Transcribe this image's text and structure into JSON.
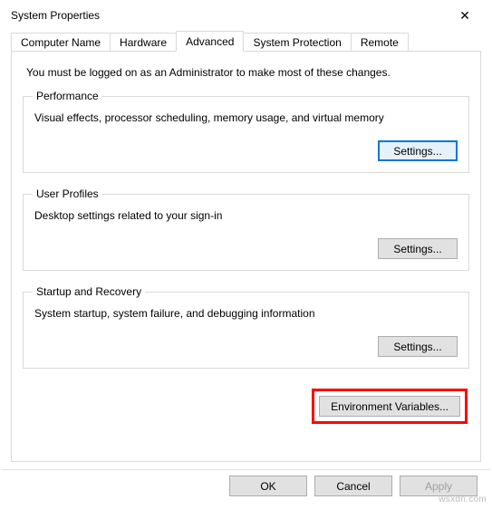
{
  "window": {
    "title": "System Properties",
    "close_glyph": "✕"
  },
  "tabs": {
    "computer_name": "Computer Name",
    "hardware": "Hardware",
    "advanced": "Advanced",
    "system_protection": "System Protection",
    "remote": "Remote"
  },
  "advanced_tab": {
    "intro": "You must be logged on as an Administrator to make most of these changes.",
    "performance": {
      "legend": "Performance",
      "desc": "Visual effects, processor scheduling, memory usage, and virtual memory",
      "settings_label": "Settings..."
    },
    "user_profiles": {
      "legend": "User Profiles",
      "desc": "Desktop settings related to your sign-in",
      "settings_label": "Settings..."
    },
    "startup_recovery": {
      "legend": "Startup and Recovery",
      "desc": "System startup, system failure, and debugging information",
      "settings_label": "Settings..."
    },
    "env_variables_label": "Environment Variables..."
  },
  "dialog_buttons": {
    "ok": "OK",
    "cancel": "Cancel",
    "apply": "Apply"
  },
  "watermark": "wsxdn.com"
}
